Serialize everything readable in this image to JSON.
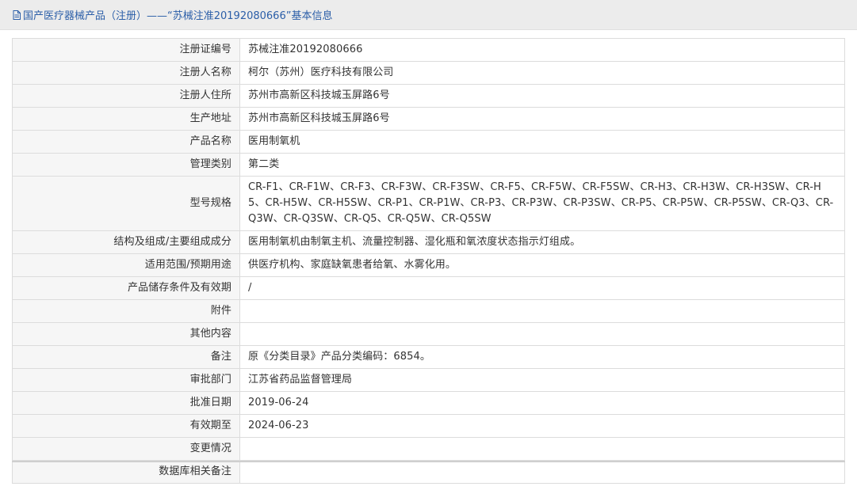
{
  "page": {
    "title": "国产医疗器械产品（注册）——“苏械注准20192080666”基本信息",
    "title_icon": "document-icon",
    "accent_color": "#2b5ea8"
  },
  "rows": [
    {
      "label": "注册证编号",
      "value": "苏械注准20192080666"
    },
    {
      "label": "注册人名称",
      "value": "柯尔（苏州）医疗科技有限公司"
    },
    {
      "label": "注册人住所",
      "value": "苏州市高新区科技城玉屏路6号"
    },
    {
      "label": "生产地址",
      "value": "苏州市高新区科技城玉屏路6号"
    },
    {
      "label": "产品名称",
      "value": "医用制氧机"
    },
    {
      "label": "管理类别",
      "value": "第二类"
    },
    {
      "label": "型号规格",
      "value": "CR-F1、CR-F1W、CR-F3、CR-F3W、CR-F3SW、CR-F5、CR-F5W、CR-F5SW、CR-H3、CR-H3W、CR-H3SW、CR-H5、CR-H5W、CR-H5SW、CR-P1、CR-P1W、CR-P3、CR-P3W、CR-P3SW、CR-P5、CR-P5W、CR-P5SW、CR-Q3、CR-Q3W、CR-Q3SW、CR-Q5、CR-Q5W、CR-Q5SW"
    },
    {
      "label": "结构及组成/主要组成成分",
      "value": "医用制氧机由制氧主机、流量控制器、湿化瓶和氧浓度状态指示灯组成。"
    },
    {
      "label": "适用范围/预期用途",
      "value": "供医疗机构、家庭缺氧患者给氧、水雾化用。"
    },
    {
      "label": "产品储存条件及有效期",
      "value": "/"
    },
    {
      "label": "附件",
      "value": ""
    },
    {
      "label": "其他内容",
      "value": ""
    },
    {
      "label": "备注",
      "value": "原《分类目录》产品分类编码：6854。"
    },
    {
      "label": "审批部门",
      "value": "江苏省药品监督管理局"
    },
    {
      "label": "批准日期",
      "value": "2019-06-24"
    },
    {
      "label": "有效期至",
      "value": "2024-06-23"
    },
    {
      "label": "变更情况",
      "value": ""
    },
    {
      "label": "数据库相关备注",
      "value": ""
    }
  ]
}
